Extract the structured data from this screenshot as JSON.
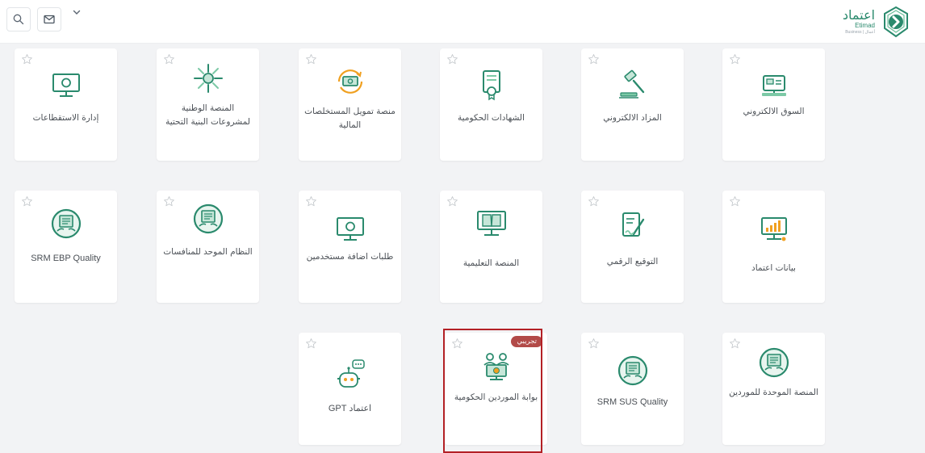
{
  "header": {
    "search_icon": "search-icon",
    "mail_icon": "mail-icon",
    "chevron_icon": "chevron-down-icon",
    "logo": {
      "arabic": "اعتماد",
      "english": "Etimad",
      "tagline": "Business | أعمال"
    }
  },
  "colors": {
    "accent": "#2a8a6d",
    "highlight": "#b32025",
    "badge": "#b24a48"
  },
  "tiles": [
    {
      "label": "السوق الالكتروني",
      "icon": "e-market-icon"
    },
    {
      "label": "المزاد الالكتروني",
      "icon": "auction-gavel-icon"
    },
    {
      "label": "الشهادات الحكومية",
      "icon": "certificate-icon"
    },
    {
      "label": "منصة تمويل المستخلصات المالية",
      "icon": "finance-icon"
    },
    {
      "label": "المنصة الوطنية لمشروعات البنية التحتية",
      "icon": "infrastructure-icon"
    },
    {
      "label": "إدارة الاستقطاعات",
      "icon": "monitor-icon"
    },
    {
      "label": "بيانات اعتماد",
      "icon": "data-chart-icon"
    },
    {
      "label": "التوقيع الرقمي",
      "icon": "digital-signature-icon"
    },
    {
      "label": "المنصة التعليمية",
      "icon": "education-book-icon"
    },
    {
      "label": "طلبات اضافة مستخدمين",
      "icon": "monitor-icon"
    },
    {
      "label": "النظام الموحد للمنافسات",
      "icon": "tenders-icon"
    },
    {
      "label": "SRM EBP Quality",
      "icon": "srm-icon"
    },
    {
      "label": "المنصة الموحدة للموردين",
      "icon": "srm-icon"
    },
    {
      "label": "SRM SUS Quality",
      "icon": "srm-icon"
    },
    {
      "label": "بوابة الموردين الحكومية",
      "icon": "suppliers-portal-icon",
      "badge": "تجريبي"
    },
    {
      "label": "اعتماد GPT",
      "icon": "robot-icon"
    }
  ]
}
